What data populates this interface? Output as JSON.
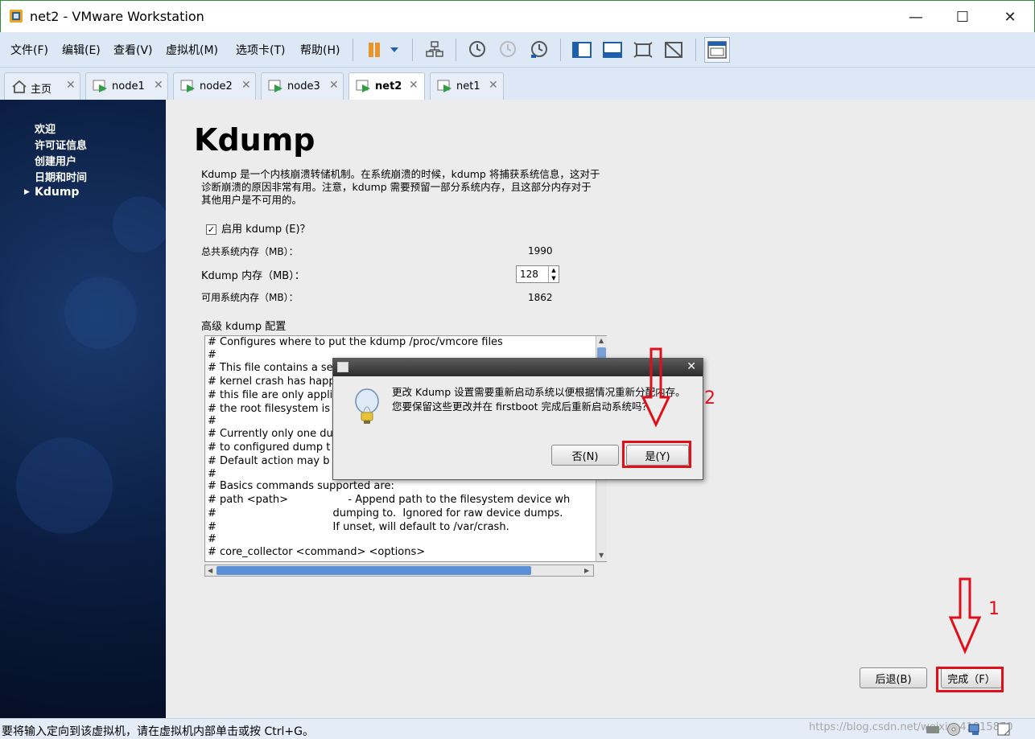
{
  "window": {
    "title": "net2 - VMware Workstation",
    "minimize": "—",
    "maximize": "☐",
    "close": "✕"
  },
  "menu": [
    "文件(F)",
    "编辑(E)",
    "查看(V)",
    "虚拟机(M)",
    "选项卡(T)",
    "帮助(H)"
  ],
  "tabs": [
    {
      "label": "主页",
      "icon": "home-icon"
    },
    {
      "label": "node1",
      "icon": "vm-icon"
    },
    {
      "label": "node2",
      "icon": "vm-icon"
    },
    {
      "label": "node3",
      "icon": "vm-icon"
    },
    {
      "label": "net2",
      "icon": "vm-icon",
      "active": true
    },
    {
      "label": "net1",
      "icon": "vm-icon"
    }
  ],
  "sidebar": {
    "items": [
      "欢迎",
      "许可证信息",
      "创建用户",
      "日期和时间",
      "Kdump"
    ],
    "current": "Kdump"
  },
  "content": {
    "title": "Kdump",
    "intro": "Kdump 是一个内核崩溃转储机制。在系统崩溃的时候，kdump 将捕获系统信息，这对于诊断崩溃的原因非常有用。注意，kdump 需要预留一部分系统内存，且这部分内存对于其他用户是不可用的。",
    "enable_label": "启用 kdump (E)？",
    "enable_checked": "✓",
    "total_mem_label": "总共系统内存（MB）：",
    "total_mem_value": "1990",
    "kdump_mem_label": "Kdump 内存（MB）：",
    "kdump_mem_value": "128",
    "avail_mem_label": "可用系统内存（MB）：",
    "avail_mem_value": "1862",
    "advanced_label": "高级 kdump 配置",
    "config_lines": [
      "# Configures where to put the kdump /proc/vmcore files",
      "#",
      "# This file contains a se",
      "# kernel crash has happ",
      "# this file are only appli",
      "# the root filesystem is",
      "#",
      "# Currently only one du",
      "# to configured dump t",
      "# Default action may b",
      "#",
      "# Basics commands supported are:",
      "# path <path>                  - Append path to the filesystem device wh",
      "#                                   dumping to.  Ignored for raw device dumps.",
      "#                                   If unset, will default to /var/crash.",
      "#",
      "# core_collector <command> <options>"
    ],
    "back_label": "后退(B)",
    "finish_label": "完成（F）"
  },
  "dialog": {
    "message": "更改 Kdump 设置需要重新启动系统以便根据情况重新分配内存。 您要保留这些更改并在 firstboot 完成后重新启动系统吗？",
    "no_label": "否(N)",
    "yes_label": "是(Y)",
    "close": "✕"
  },
  "annotations": {
    "step1": "1",
    "step2": "2",
    "color": "#e0101a"
  },
  "statusbar": {
    "text": "要将输入定向到该虚拟机，请在虚拟机内部单击或按 Ctrl+G。",
    "watermark": "https://blog.csdn.net/weixin_41815870"
  }
}
